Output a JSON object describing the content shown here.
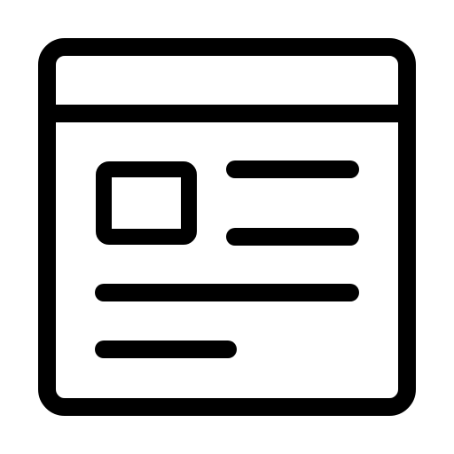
{
  "icon": {
    "name": "webpage-layout-icon",
    "stroke_color": "#000000",
    "background_color": "#ffffff"
  }
}
